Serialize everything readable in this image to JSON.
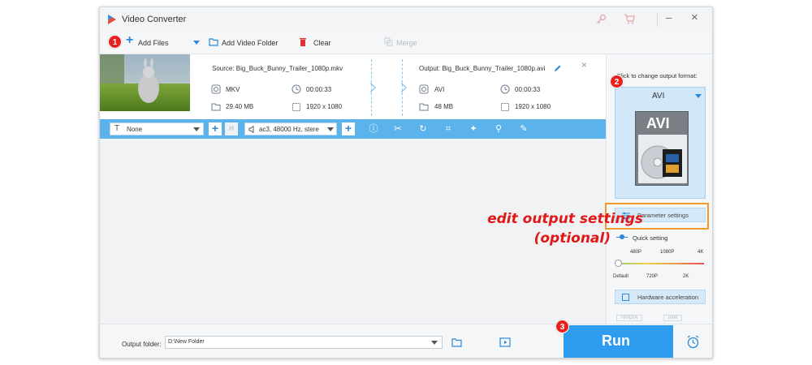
{
  "window": {
    "title": "Video Converter",
    "minimize": "–",
    "close": "×"
  },
  "toolbar": {
    "add_files": "Add Files",
    "add_video_folder": "Add Video Folder",
    "clear": "Clear",
    "merge": "Merge"
  },
  "file": {
    "source": "Source: Big_Buck_Bunny_Trailer_1080p.mkv",
    "output": "Output: Big_Buck_Bunny_Trailer_1080p.avi",
    "src_format": "MKV",
    "src_duration": "00:00:33",
    "src_size": "29.40 MB",
    "src_resolution": "1920 x 1080",
    "out_format": "AVI",
    "out_duration": "00:00:33",
    "out_size": "48 MB",
    "out_resolution": "1920 x 1080"
  },
  "strip": {
    "subtitle_select": "None",
    "audio_select": "ac3, 48000 Hz, stere"
  },
  "right_panel": {
    "format_hint": "Click to change output format:",
    "format_name": "AVI",
    "format_logo": "AVI",
    "param_settings": "Parameter settings",
    "quick_setting": "Quick setting",
    "quality_top": [
      "480P",
      "1080P",
      "4K"
    ],
    "quality_bottom": [
      "Default",
      "720P",
      "2K"
    ],
    "quality_level": 0,
    "hw_accel": "Hardware acceleration",
    "nvidia": "NVIDIA",
    "intel": "Intel"
  },
  "bottom": {
    "output_folder_label": "Output folder:",
    "output_folder_value": "D:\\New Folder",
    "run": "Run"
  },
  "annotation": {
    "line1": "edit output settings",
    "line2": "(optional)"
  },
  "badges": [
    "1",
    "2",
    "3"
  ],
  "colors": {
    "accent": "#2e9df0",
    "badge": "#e8201f",
    "highlight": "#f39a2e",
    "annotation": "#e01818"
  }
}
